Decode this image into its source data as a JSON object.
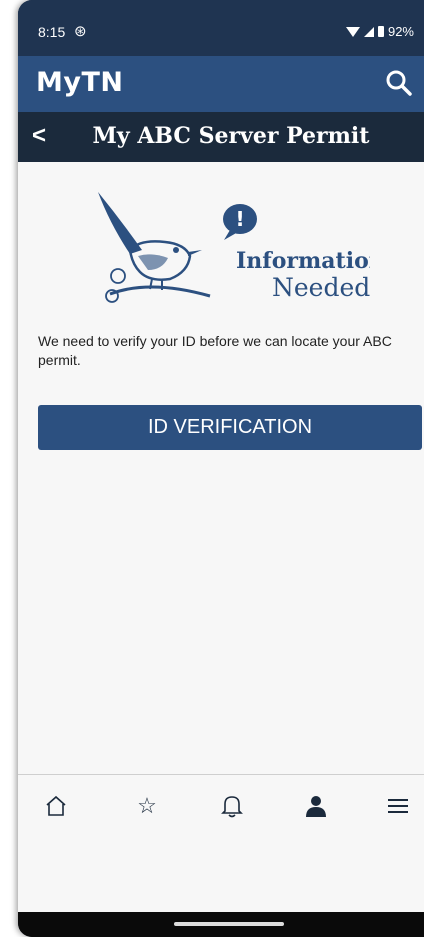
{
  "status_bar": {
    "time": "8:15",
    "battery": "92%"
  },
  "app_bar": {
    "logo": "MyTN",
    "search_icon": "search-icon"
  },
  "sub_header": {
    "back": "<",
    "title": "My ABC Server Permit"
  },
  "illustration": {
    "line1": "Information",
    "line2": "Needed",
    "alert_mark": "!"
  },
  "message": "We need to verify your ID before we can locate your ABC permit.",
  "button": {
    "label": "ID VERIFICATION"
  },
  "bottom_nav": {
    "items": [
      {
        "name": "home",
        "icon": "home-icon"
      },
      {
        "name": "favorites",
        "icon": "star-icon"
      },
      {
        "name": "notifications",
        "icon": "bell-icon"
      },
      {
        "name": "profile",
        "icon": "person-icon"
      },
      {
        "name": "menu",
        "icon": "menu-icon"
      }
    ]
  },
  "colors": {
    "primary": "#2c5080",
    "dark": "#1b2a3c",
    "background": "#f7f7f7"
  }
}
